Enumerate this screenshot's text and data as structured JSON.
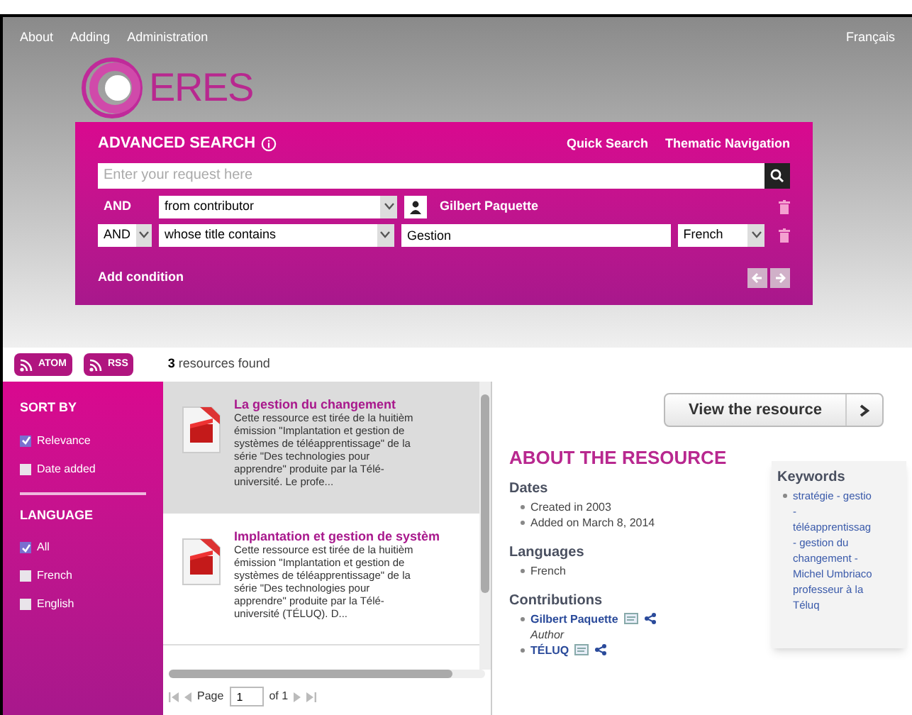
{
  "top_nav": {
    "links": [
      "About",
      "Adding",
      "Administration"
    ],
    "language": "Français"
  },
  "logo": {
    "text": "ERES"
  },
  "advanced_search": {
    "title": "ADVANCED SEARCH",
    "links": [
      "Quick Search",
      "Thematic Navigation"
    ],
    "search": {
      "placeholder": "Enter your request here"
    },
    "conditions": [
      {
        "operator": "AND",
        "operator_dropdown": false,
        "field": "from contributor",
        "kind": "contributor",
        "value": "Gilbert Paquette"
      },
      {
        "operator": "AND",
        "operator_dropdown": true,
        "field": "whose title contains",
        "kind": "text",
        "value": "Gestion",
        "language": "French"
      }
    ],
    "add_condition": "Add condition"
  },
  "feeds": [
    "ATOM",
    "RSS"
  ],
  "results_count": {
    "number": "3",
    "label": "resources found"
  },
  "sidebar": {
    "sections": [
      {
        "title": "SORT BY",
        "options": [
          {
            "label": "Relevance",
            "checked": true
          },
          {
            "label": "Date added",
            "checked": false
          }
        ]
      },
      {
        "title": "LANGUAGE",
        "options": [
          {
            "label": "All",
            "checked": true
          },
          {
            "label": "French",
            "checked": false
          },
          {
            "label": "English",
            "checked": false
          }
        ]
      }
    ]
  },
  "results": [
    {
      "title": "La gestion du changement",
      "selected": true,
      "description": [
        "Cette ressource est tirée de la huitièm",
        "émission \"Implantation et gestion de",
        "systèmes de téléapprentissage\" de la",
        "série \"Des technologies pour",
        "apprendre\" produite par la Télé-",
        "université. Le profe..."
      ]
    },
    {
      "title": "Implantation et gestion de systèm",
      "selected": false,
      "description": [
        "Cette ressource est tirée de la huitièm",
        "émission \"Implantation et gestion de",
        "systèmes de téléapprentissage\" de la",
        "série \"Des technologies pour",
        "apprendre\" produite par la Télé-",
        "université (TÉLUQ). D..."
      ]
    }
  ],
  "pagination": {
    "page_label": "Page",
    "page": "1",
    "of": "of 1"
  },
  "detail": {
    "view_button": "View the resource",
    "heading": "ABOUT THE RESOURCE",
    "sections": [
      {
        "title": "Dates",
        "items": [
          {
            "text": "Created in 2003"
          },
          {
            "text": "Added on March 8, 2014"
          }
        ]
      },
      {
        "title": "Languages",
        "items": [
          {
            "text": "French"
          }
        ]
      },
      {
        "title": "Contributions",
        "items": [
          {
            "text": "Gilbert Paquette",
            "role": "Author",
            "kind": "contributor"
          },
          {
            "text": "TÉLUQ",
            "kind": "contributor"
          }
        ]
      }
    ],
    "keywords": {
      "title": "Keywords",
      "lines": [
        "stratégie - gestio",
        "-",
        "téléapprentissag",
        "- gestion du",
        "changement -",
        "Michel Umbriaco",
        "professeur à la",
        "Téluq"
      ]
    }
  }
}
